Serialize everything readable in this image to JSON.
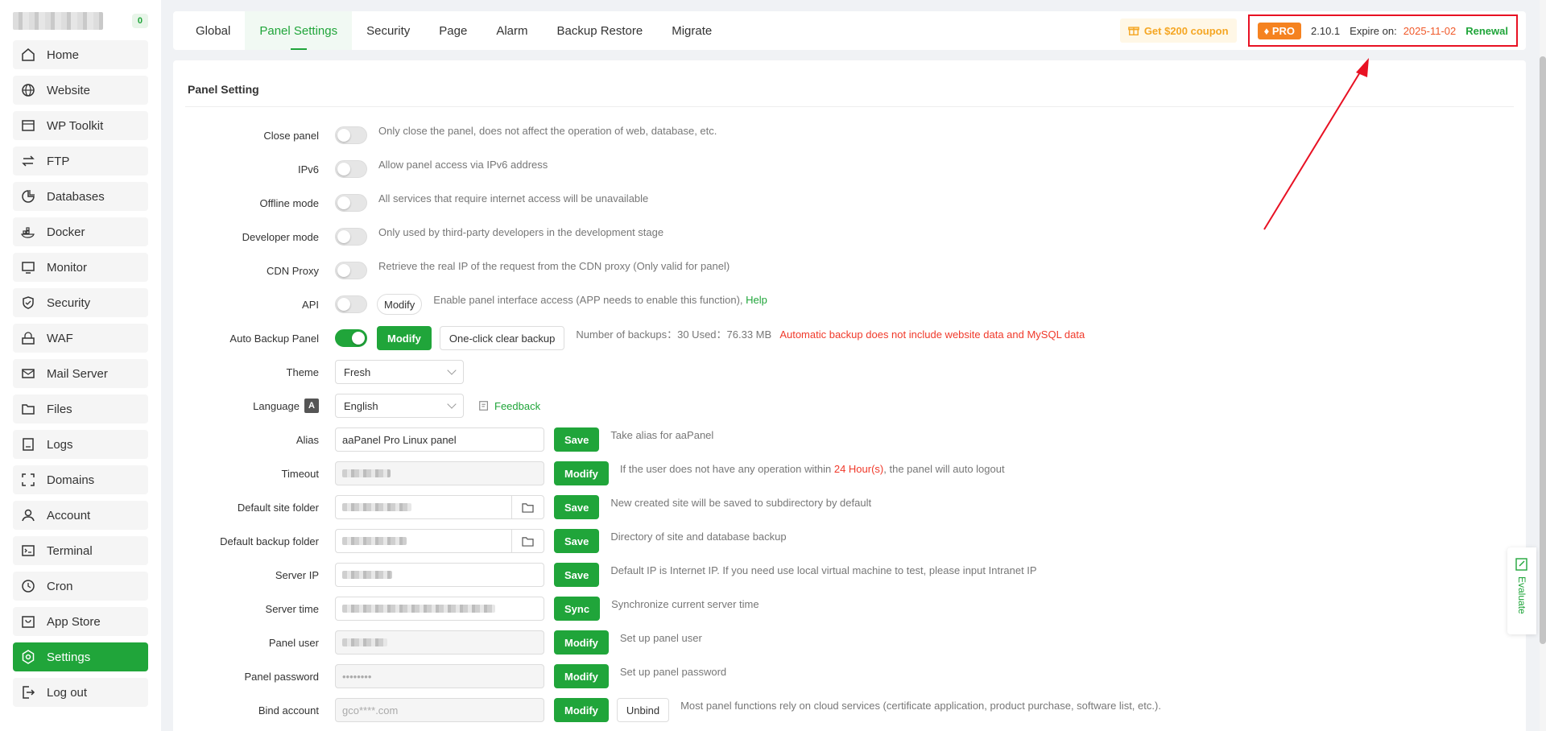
{
  "sidebar": {
    "badge": "0",
    "items": [
      {
        "label": "Home",
        "icon": "home-icon"
      },
      {
        "label": "Website",
        "icon": "globe-icon"
      },
      {
        "label": "WP Toolkit",
        "icon": "wp-icon"
      },
      {
        "label": "FTP",
        "icon": "transfer-icon"
      },
      {
        "label": "Databases",
        "icon": "database-icon"
      },
      {
        "label": "Docker",
        "icon": "docker-icon"
      },
      {
        "label": "Monitor",
        "icon": "monitor-icon"
      },
      {
        "label": "Security",
        "icon": "shield-icon"
      },
      {
        "label": "WAF",
        "icon": "firewall-icon"
      },
      {
        "label": "Mail Server",
        "icon": "mail-icon"
      },
      {
        "label": "Files",
        "icon": "folder-icon"
      },
      {
        "label": "Logs",
        "icon": "log-icon"
      },
      {
        "label": "Domains",
        "icon": "domain-icon"
      },
      {
        "label": "Account",
        "icon": "user-icon"
      },
      {
        "label": "Terminal",
        "icon": "terminal-icon"
      },
      {
        "label": "Cron",
        "icon": "clock-icon"
      },
      {
        "label": "App Store",
        "icon": "store-icon"
      },
      {
        "label": "Settings",
        "icon": "gear-icon",
        "active": true
      },
      {
        "label": "Log out",
        "icon": "logout-icon"
      }
    ]
  },
  "tabs": [
    "Global",
    "Panel Settings",
    "Security",
    "Page",
    "Alarm",
    "Backup Restore",
    "Migrate"
  ],
  "active_tab": "Panel Settings",
  "topbar": {
    "coupon": "Get $200 coupon",
    "pro_badge": "PRO",
    "version": "2.10.1",
    "expire_label": "Expire on:",
    "expire_date": "2025-11-02",
    "renewal": "Renewal"
  },
  "section_title": "Panel Setting",
  "rows": {
    "close_panel": {
      "label": "Close panel",
      "desc": "Only close the panel, does not affect the operation of web, database, etc."
    },
    "ipv6": {
      "label": "IPv6",
      "desc": "Allow panel access via IPv6 address"
    },
    "offline": {
      "label": "Offline mode",
      "desc": "All services that require internet access will be unavailable"
    },
    "developer": {
      "label": "Developer mode",
      "desc": "Only used by third-party developers in the development stage"
    },
    "cdn": {
      "label": "CDN Proxy",
      "desc": "Retrieve the real IP of the request from the CDN proxy  (Only valid for panel)"
    },
    "api": {
      "label": "API",
      "button": "Modify",
      "desc": "Enable panel interface access (APP needs to enable this function),",
      "link": "Help"
    },
    "auto_backup": {
      "label": "Auto Backup Panel",
      "button": "Modify",
      "button2": "One-click clear backup",
      "desc": "Number of backups：30   Used：76.33 MB",
      "warning": "Automatic backup does not include website data and MySQL data"
    },
    "theme": {
      "label": "Theme",
      "value": "Fresh"
    },
    "language": {
      "label": "Language",
      "icon_text": "A",
      "value": "English",
      "feedback": "Feedback"
    },
    "alias": {
      "label": "Alias",
      "value": "aaPanel Pro Linux panel",
      "button": "Save",
      "desc": "Take alias for aaPanel"
    },
    "timeout": {
      "label": "Timeout",
      "button": "Modify",
      "desc_pre": "If the user does not have any operation within ",
      "desc_hl": "24 Hour(s)",
      "desc_post": ", the panel will auto logout"
    },
    "site_folder": {
      "label": "Default site folder",
      "button": "Save",
      "desc": "New created site will be saved to subdirectory by default"
    },
    "backup_folder": {
      "label": "Default backup folder",
      "button": "Save",
      "desc": "Directory of site and database backup"
    },
    "server_ip": {
      "label": "Server IP",
      "button": "Save",
      "desc": "Default IP is Internet IP. If you need use local virtual machine to test, please input Intranet IP"
    },
    "server_time": {
      "label": "Server time",
      "button": "Sync",
      "desc": "Synchronize current server time"
    },
    "panel_user": {
      "label": "Panel user",
      "button": "Modify",
      "desc": "Set up panel user"
    },
    "panel_password": {
      "label": "Panel password",
      "value": "••••••••",
      "button": "Modify",
      "desc": "Set up panel password"
    },
    "bind_account": {
      "label": "Bind account",
      "value": "gco****.com",
      "button": "Modify",
      "button2": "Unbind",
      "desc": "Most panel functions rely on cloud services (certificate application, product purchase, software list, etc.)."
    }
  },
  "evaluate": "Evaluate",
  "colors": {
    "accent": "#20a53a",
    "warning": "#f0392a",
    "orange": "#f58220",
    "annotation": "#e81123"
  }
}
